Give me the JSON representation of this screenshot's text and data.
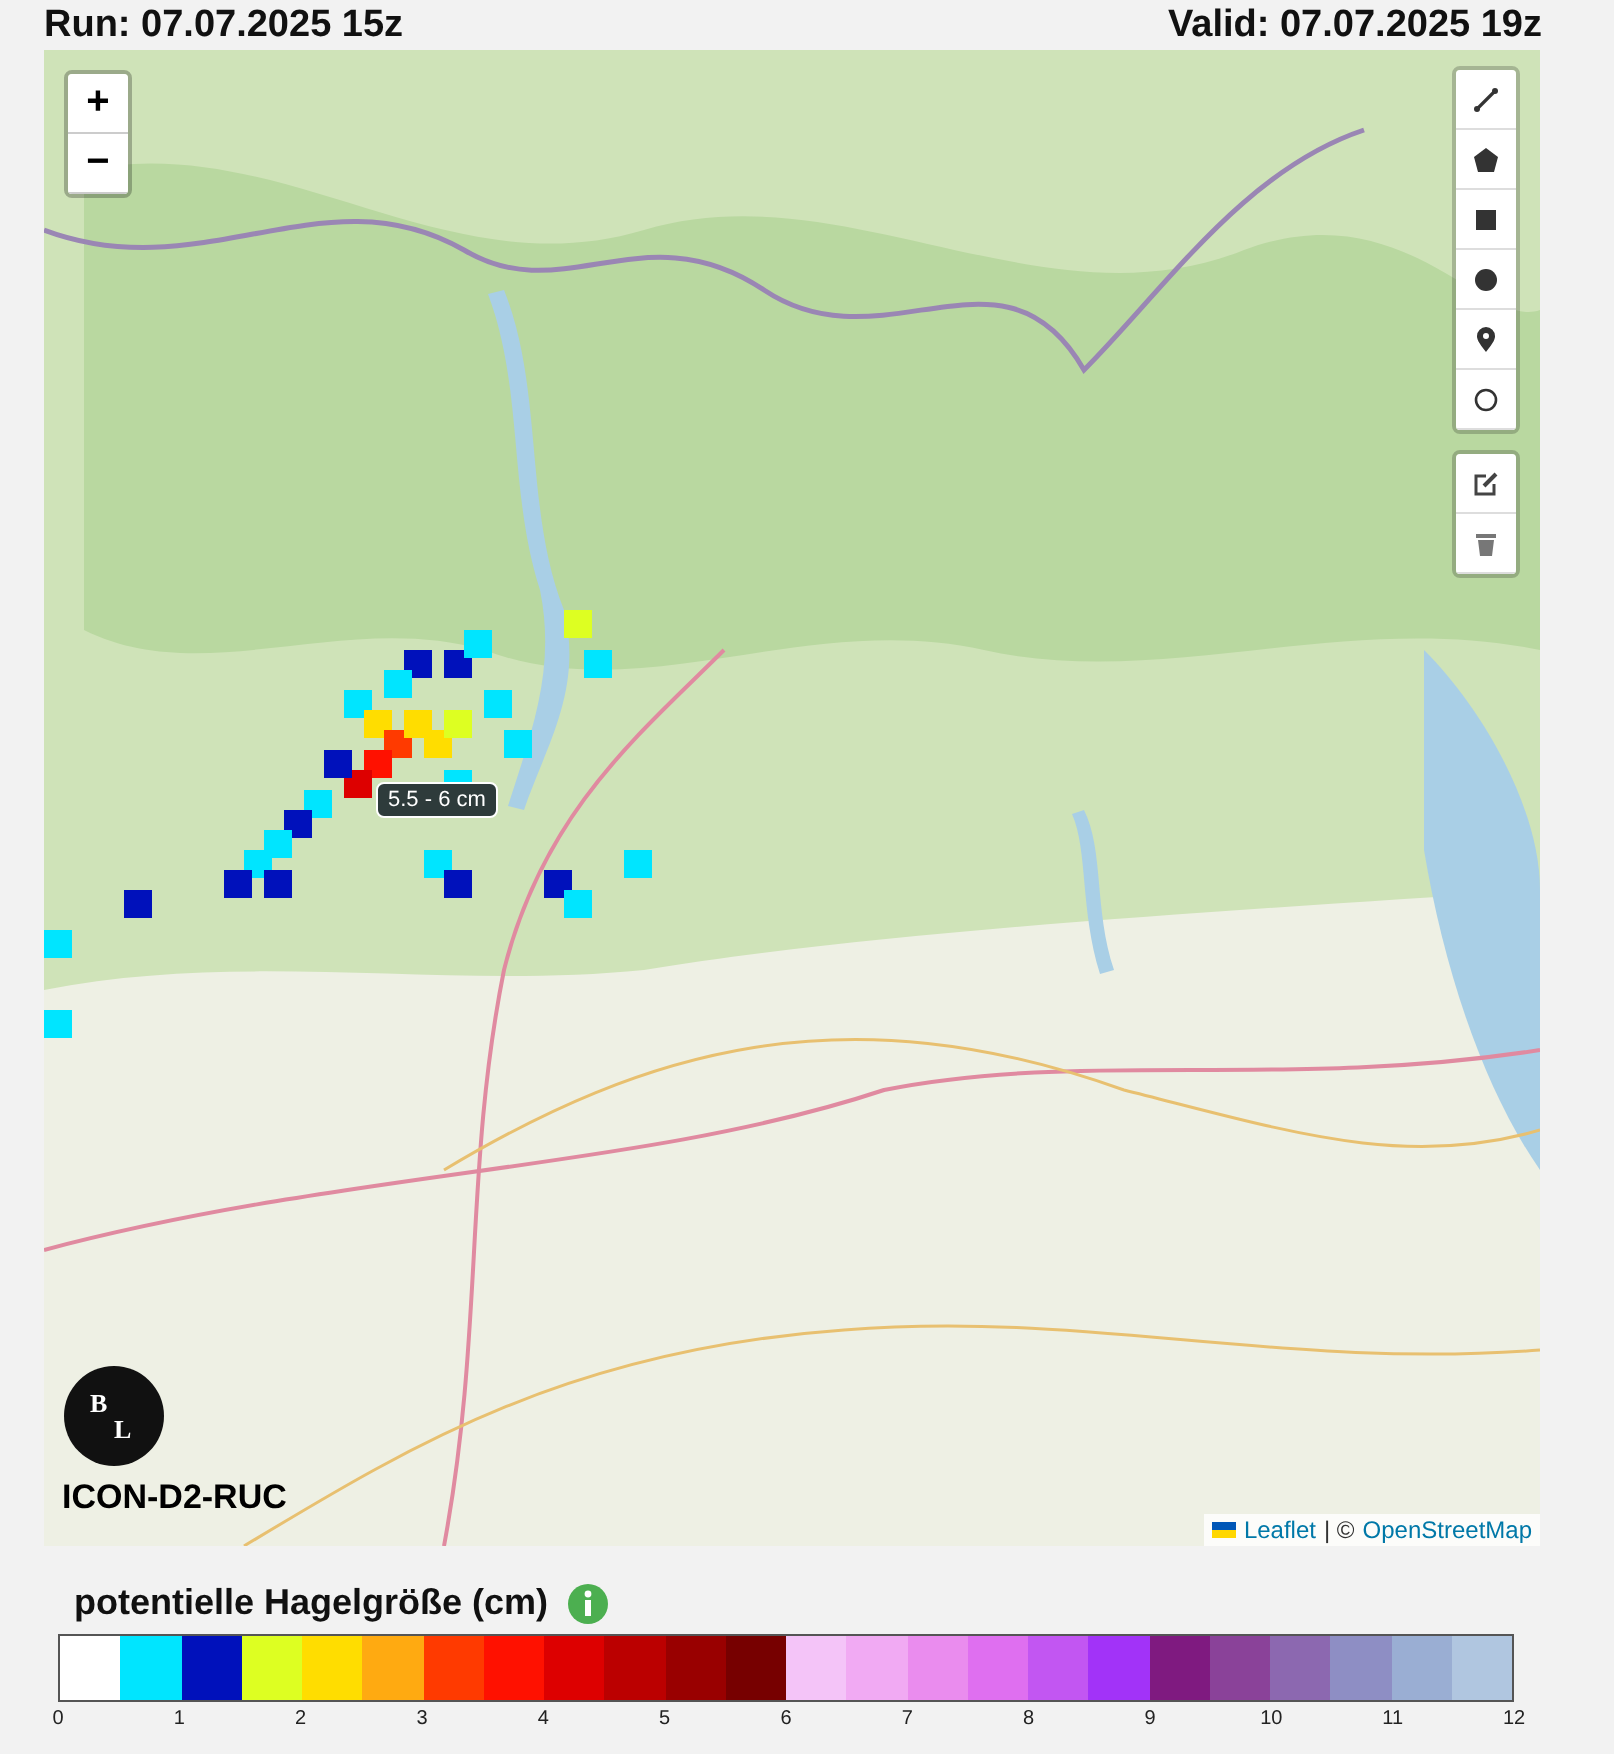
{
  "header": {
    "run": "Run: 07.07.2025 15z",
    "valid": "Valid: 07.07.2025 19z"
  },
  "map": {
    "zoom_buttons": [
      "+",
      "−"
    ],
    "draw_tools": [
      {
        "kind": "polyline"
      },
      {
        "kind": "polygon"
      },
      {
        "kind": "rectangle"
      },
      {
        "kind": "circle"
      },
      {
        "kind": "marker"
      },
      {
        "kind": "circlemarker"
      }
    ],
    "edit_tools": [
      {
        "kind": "edit"
      },
      {
        "kind": "delete"
      }
    ],
    "tooltip": "5.5 - 6 cm",
    "logo": {
      "letters": [
        "B",
        "L"
      ]
    },
    "model": "ICON-D2-RUC",
    "attribution": {
      "leaflet": "Leaflet",
      "separator": "| ©",
      "osm": "OpenStreetMap"
    }
  },
  "legend": {
    "title": "potentielle Hagelgröße (cm)",
    "segments": [
      {
        "color": "#ffffff"
      },
      {
        "color": "#00e5ff"
      },
      {
        "color": "#0011bb"
      },
      {
        "color": "#ddff22"
      },
      {
        "color": "#ffdd00"
      },
      {
        "color": "#ffaa11"
      },
      {
        "color": "#ff3a00"
      },
      {
        "color": "#ff1100"
      },
      {
        "color": "#dd0000"
      },
      {
        "color": "#bb0000"
      },
      {
        "color": "#990000"
      },
      {
        "color": "#770000"
      },
      {
        "color": "#f4c4f8"
      },
      {
        "color": "#f1aaf3"
      },
      {
        "color": "#ea8cee"
      },
      {
        "color": "#df6ff0"
      },
      {
        "color": "#c256f2"
      },
      {
        "color": "#a233f8"
      },
      {
        "color": "#7f1a80"
      },
      {
        "color": "#8a4299"
      },
      {
        "color": "#8c68b0"
      },
      {
        "color": "#8e8ec4"
      },
      {
        "color": "#9aaed3"
      },
      {
        "color": "#b0c6e0"
      }
    ],
    "ticks": [
      "0",
      "1",
      "2",
      "3",
      "4",
      "5",
      "6",
      "7",
      "8",
      "9",
      "10",
      "11",
      "12"
    ]
  }
}
